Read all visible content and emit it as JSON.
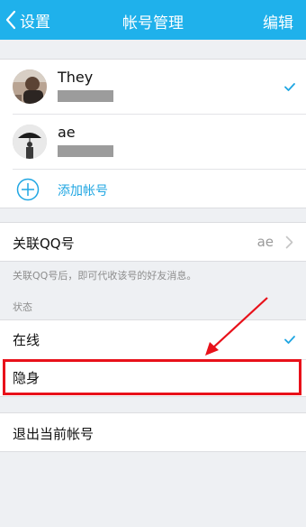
{
  "navbar": {
    "back_label": "设置",
    "title": "帐号管理",
    "edit_label": "编辑"
  },
  "accounts": [
    {
      "name": "They",
      "selected": true
    },
    {
      "name": "ae",
      "selected": false
    }
  ],
  "add_account_label": "添加帐号",
  "linked_qq": {
    "label": "关联QQ号",
    "value": "ae",
    "caption": "关联QQ号后，即可代收该号的好友消息。"
  },
  "status": {
    "section_label": "状态",
    "options": [
      {
        "label": "在线",
        "selected": true
      },
      {
        "label": "隐身",
        "selected": false
      }
    ]
  },
  "logout_label": "退出当前帐号",
  "colors": {
    "nav_bg": "#1fb1eb",
    "accent": "#1fa6e2",
    "annotation": "#e8111a"
  }
}
